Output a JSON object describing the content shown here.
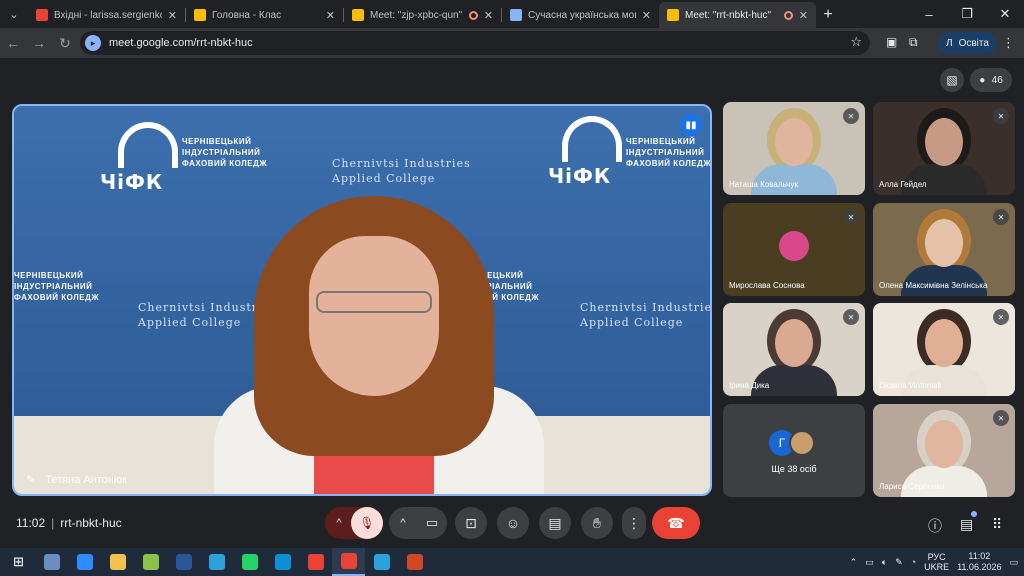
{
  "browser": {
    "tabs": [
      {
        "title": "Вхідні - larissa.sergienko@lispk",
        "icon": "gmail-icon",
        "color": "#ea4335"
      },
      {
        "title": "Головна - Клас",
        "icon": "classroom-icon",
        "color": "#fbbc04"
      },
      {
        "title": "Meet: \"zjp-xpbc-qun\"",
        "icon": "meet-icon",
        "color": "#fbbc04",
        "recording": true
      },
      {
        "title": "Сучасна українська мова з пр",
        "icon": "docs-icon",
        "color": "#8ab4f8"
      },
      {
        "title": "Meet: \"rrt-nbkt-huc\"",
        "icon": "meet-icon",
        "color": "#fbbc04",
        "recording": true,
        "active": true
      }
    ],
    "url": "meet.google.com/rrt-nbkt-huc",
    "profile_initial": "Л",
    "profile_label": "Освіта"
  },
  "meet": {
    "participant_count": "46",
    "main_speaker": {
      "name": "Тетяна Антонюк",
      "backdrop": {
        "logo": "ЧіФК",
        "college_ua": "ЧЕРНІВЕЦЬКИЙ\nІНДУСТРІАЛЬНИЙ\nФАХОВИЙ КОЛЕДЖ",
        "college_en": "Chernivtsi Industries\nApplied College"
      }
    },
    "tiles": [
      {
        "name": "Наташа Ковальчук",
        "bg": "#c9c2b6",
        "skin": "#e0b59e",
        "hair": "#c8b079",
        "top": "#8fb7d8"
      },
      {
        "name": "Алла Гейдел",
        "bg": "#3a2f2b",
        "skin": "#c79a86",
        "hair": "#1e1a19",
        "top": "#2b2b2b"
      },
      {
        "name": "Мирослава Соснова",
        "bg": "#4a3d21",
        "avatar": true
      },
      {
        "name": "Олена Максимівна Зелінська",
        "bg": "#7b6a4d",
        "skin": "#e6c2a8",
        "hair": "#b07a3a",
        "top": "#1f3550"
      },
      {
        "name": "Ірина Дика",
        "bg": "#d8d2c8",
        "skin": "#d9a990",
        "hair": "#4c3a35",
        "top": "#2f2f3a"
      },
      {
        "name": "Oksana Vintoniak",
        "bg": "#ece6dc",
        "skin": "#e0b095",
        "hair": "#3d2c24",
        "top": "#e8e2d8"
      },
      {
        "name": "Лариса Сергієнко",
        "bg": "#b7a79a",
        "skin": "#e1b6a1",
        "hair": "#d8cfc6",
        "top": "#f0ece6"
      }
    ],
    "more_count_label": "Ще 38 осіб",
    "more_initial": "Г",
    "clock": "11:02",
    "meeting_code": "rrt-nbkt-huc"
  },
  "taskbar": {
    "apps": [
      {
        "name": "windows-start",
        "color": "#1f2a3a"
      },
      {
        "name": "microsoft-store-app",
        "color": "#6c8ebf"
      },
      {
        "name": "zoom-app",
        "color": "#2d8cff"
      },
      {
        "name": "file-explorer-app",
        "color": "#f2c14e"
      },
      {
        "name": "paint-app",
        "color": "#8bc34a"
      },
      {
        "name": "word-app",
        "color": "#2b579a"
      },
      {
        "name": "telegram-app",
        "color": "#2aa3dd"
      },
      {
        "name": "whatsapp-app",
        "color": "#25d366"
      },
      {
        "name": "edge-app",
        "color": "#0f8fd6"
      },
      {
        "name": "chrome-app",
        "color": "#ea4335"
      },
      {
        "name": "chrome-app-2",
        "color": "#ea4335",
        "active": true
      },
      {
        "name": "telegram-desktop-app",
        "color": "#2aa3dd"
      },
      {
        "name": "powerpoint-app",
        "color": "#d24726"
      }
    ],
    "lang_top": "РУС",
    "lang_bottom": "UKRE",
    "time": "11:02",
    "date": "11.06.2026"
  }
}
